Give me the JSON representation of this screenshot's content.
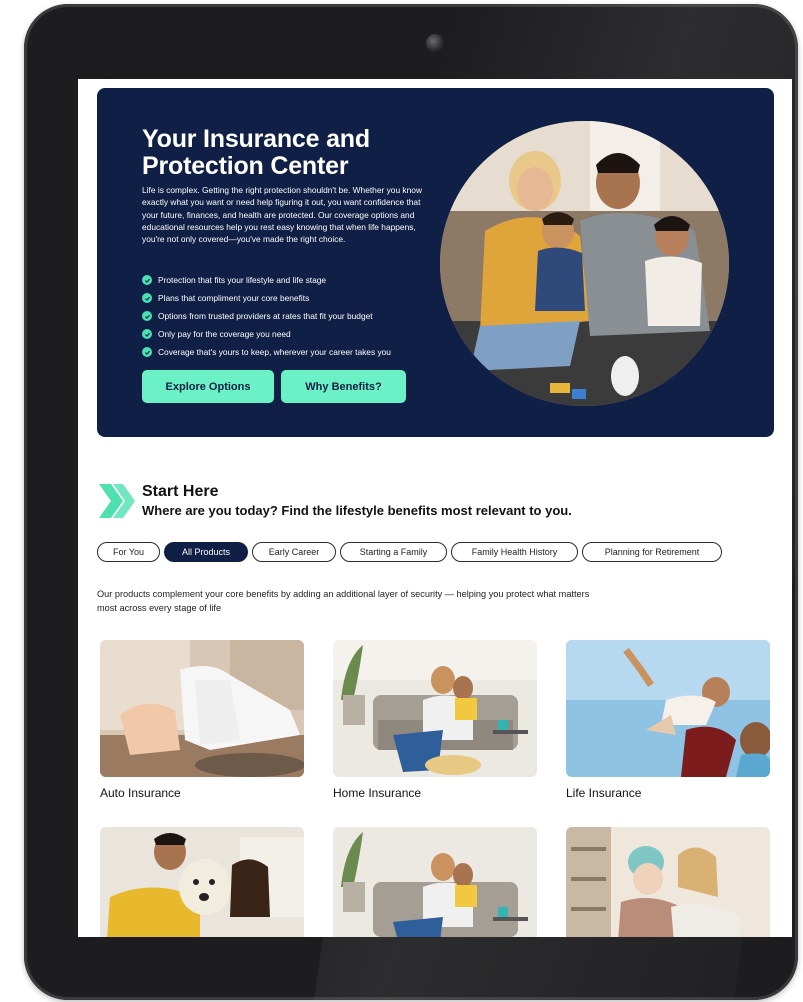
{
  "hero": {
    "title_line1": "Your Insurance and",
    "title_line2": "Protection Center",
    "description": "Life is complex. Getting the right protection shouldn't be. Whether you know exactly what you want or need help figuring it out, you want confidence that your future, finances, and health are protected. Our coverage options and educational resources help you rest easy knowing that when life happens, you're not only covered—you've made the right choice.",
    "bullets": [
      "Protection that fits your lifestyle and life stage",
      "Plans that compliment your core benefits",
      "Options from trusted providers at rates that fit your budget",
      "Only pay for the coverage you need",
      "Coverage that's yours to keep, wherever your career takes you"
    ],
    "explore_label": "Explore Options",
    "why_label": "Why Benefits?"
  },
  "start_here": {
    "title": "Start Here",
    "subtitle": "Where are you today? Find the lifestyle benefits most relevant to you."
  },
  "chips": [
    {
      "label": "For You",
      "active": false
    },
    {
      "label": "All Products",
      "active": true
    },
    {
      "label": "Early Career",
      "active": false
    },
    {
      "label": "Starting a Family",
      "active": false
    },
    {
      "label": "Family Health History",
      "active": false
    },
    {
      "label": "Planning for Retirement",
      "active": false
    }
  ],
  "intro_text": "Our products complement your core benefits by adding an additional layer of security — helping you protect what matters most across every stage of life",
  "cards": [
    {
      "label": "Auto Insurance"
    },
    {
      "label": "Home Insurance"
    },
    {
      "label": "Life Insurance"
    }
  ],
  "colors": {
    "navy": "#101f45",
    "mint": "#6cf1c6",
    "check": "#49e0b4"
  }
}
